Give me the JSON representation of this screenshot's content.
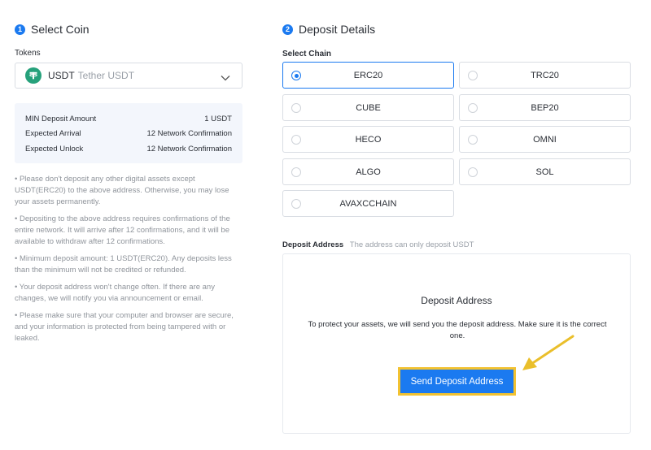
{
  "left": {
    "step_number": "1",
    "title": "Select Coin",
    "tokens_label": "Tokens",
    "token": {
      "symbol": "USDT",
      "name": "Tether USDT",
      "icon": "tether-icon"
    },
    "info": [
      {
        "label": "MIN Deposit Amount",
        "value": "1 USDT"
      },
      {
        "label": "Expected Arrival",
        "value": "12 Network Confirmation"
      },
      {
        "label": "Expected Unlock",
        "value": "12 Network Confirmation"
      }
    ],
    "notes": [
      "• Please don't deposit any other digital assets except USDT(ERC20) to the above address. Otherwise, you may lose your assets permanently.",
      "• Depositing to the above address requires confirmations of the entire network. It will arrive after 12 confirmations, and it will be available to withdraw after 12 confirmations.",
      "• Minimum deposit amount: 1 USDT(ERC20). Any deposits less than the minimum will not be credited or refunded.",
      "• Your deposit address won't change often. If there are any changes, we will notify you via announcement or email.",
      "• Please make sure that your computer and browser are secure, and your information is protected from being tampered with or leaked."
    ]
  },
  "right": {
    "step_number": "2",
    "title": "Deposit Details",
    "select_chain_label": "Select Chain",
    "chains": [
      "ERC20",
      "TRC20",
      "CUBE",
      "BEP20",
      "HECO",
      "OMNI",
      "ALGO",
      "SOL",
      "AVAXCCHAIN"
    ],
    "selected_chain": "ERC20",
    "deposit_address_label": "Deposit Address",
    "deposit_address_hint": "The address can only deposit USDT",
    "box_title": "Deposit Address",
    "box_desc": "To protect your assets, we will send you the deposit address. Make sure it is the correct one.",
    "send_button": "Send Deposit Address"
  },
  "colors": {
    "accent": "#1b7af0",
    "highlight": "#f2c231",
    "tether": "#26a17b"
  }
}
